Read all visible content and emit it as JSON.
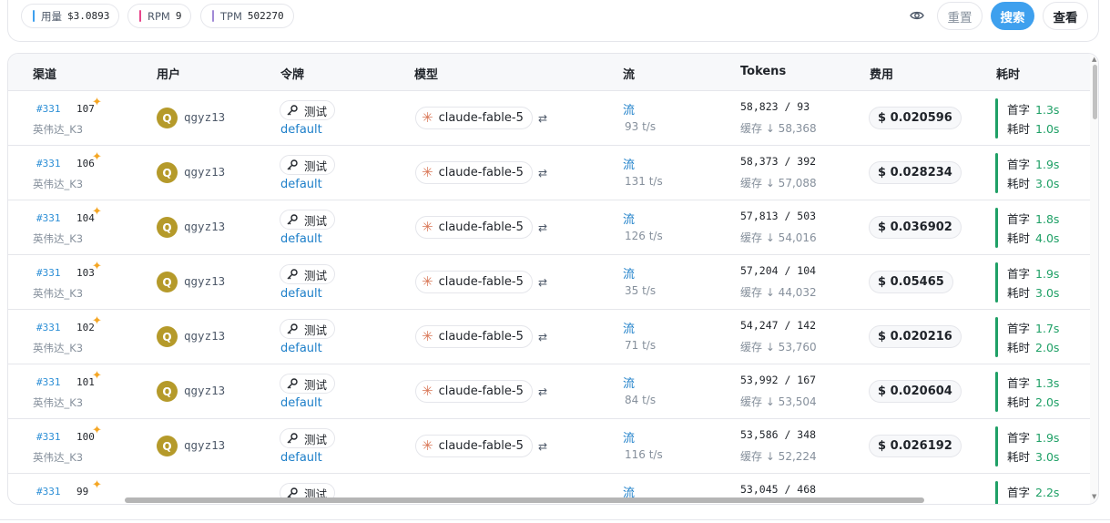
{
  "stats": {
    "usage": {
      "label": "用量",
      "value": "$3.0893",
      "color": "#3ea0ee"
    },
    "rpm": {
      "label": "RPM",
      "value": "9",
      "color": "#e8458b"
    },
    "tpm": {
      "label": "TPM",
      "value": "502270",
      "color": "#a18ad6"
    }
  },
  "actions": {
    "reset": "重置",
    "search": "搜索",
    "view": "查看"
  },
  "columns": {
    "channel": "渠道",
    "user": "用户",
    "token": "令牌",
    "model": "模型",
    "stream": "流",
    "tokens": "Tokens",
    "cost": "费用",
    "duration": "耗时"
  },
  "rows": [
    {
      "channel_id": "#331",
      "num": "107",
      "channel_name": "英伟达_K3",
      "avatar": "Q",
      "user": "qgyz13",
      "token": "测试",
      "group": "default",
      "model": "claude-fable-5",
      "stream": "流",
      "speed": "93 t/s",
      "tokens": "58,823 / 93",
      "cache": "缓存 ↓ 58,368",
      "cost": "$ 0.020596",
      "first_label": "首字",
      "first": "1.3s",
      "total_label": "耗时",
      "total": "1.0s"
    },
    {
      "channel_id": "#331",
      "num": "106",
      "channel_name": "英伟达_K3",
      "avatar": "Q",
      "user": "qgyz13",
      "token": "测试",
      "group": "default",
      "model": "claude-fable-5",
      "stream": "流",
      "speed": "131 t/s",
      "tokens": "58,373 / 392",
      "cache": "缓存 ↓ 57,088",
      "cost": "$ 0.028234",
      "first_label": "首字",
      "first": "1.9s",
      "total_label": "耗时",
      "total": "3.0s"
    },
    {
      "channel_id": "#331",
      "num": "104",
      "channel_name": "英伟达_K3",
      "avatar": "Q",
      "user": "qgyz13",
      "token": "测试",
      "group": "default",
      "model": "claude-fable-5",
      "stream": "流",
      "speed": "126 t/s",
      "tokens": "57,813 / 503",
      "cache": "缓存 ↓ 54,016",
      "cost": "$ 0.036902",
      "first_label": "首字",
      "first": "1.8s",
      "total_label": "耗时",
      "total": "4.0s"
    },
    {
      "channel_id": "#331",
      "num": "103",
      "channel_name": "英伟达_K3",
      "avatar": "Q",
      "user": "qgyz13",
      "token": "测试",
      "group": "default",
      "model": "claude-fable-5",
      "stream": "流",
      "speed": "35 t/s",
      "tokens": "57,204 / 104",
      "cache": "缓存 ↓ 44,032",
      "cost": "$ 0.05465",
      "first_label": "首字",
      "first": "1.9s",
      "total_label": "耗时",
      "total": "3.0s"
    },
    {
      "channel_id": "#331",
      "num": "102",
      "channel_name": "英伟达_K3",
      "avatar": "Q",
      "user": "qgyz13",
      "token": "测试",
      "group": "default",
      "model": "claude-fable-5",
      "stream": "流",
      "speed": "71 t/s",
      "tokens": "54,247 / 142",
      "cache": "缓存 ↓ 53,760",
      "cost": "$ 0.020216",
      "first_label": "首字",
      "first": "1.7s",
      "total_label": "耗时",
      "total": "2.0s"
    },
    {
      "channel_id": "#331",
      "num": "101",
      "channel_name": "英伟达_K3",
      "avatar": "Q",
      "user": "qgyz13",
      "token": "测试",
      "group": "default",
      "model": "claude-fable-5",
      "stream": "流",
      "speed": "84 t/s",
      "tokens": "53,992 / 167",
      "cache": "缓存 ↓ 53,504",
      "cost": "$ 0.020604",
      "first_label": "首字",
      "first": "1.3s",
      "total_label": "耗时",
      "total": "2.0s"
    },
    {
      "channel_id": "#331",
      "num": "100",
      "channel_name": "英伟达_K3",
      "avatar": "Q",
      "user": "qgyz13",
      "token": "测试",
      "group": "default",
      "model": "claude-fable-5",
      "stream": "流",
      "speed": "116 t/s",
      "tokens": "53,586 / 348",
      "cache": "缓存 ↓ 52,224",
      "cost": "$ 0.026192",
      "first_label": "首字",
      "first": "1.9s",
      "total_label": "耗时",
      "total": "3.0s"
    },
    {
      "channel_id": "#331",
      "num": "99",
      "channel_name": "",
      "avatar": "",
      "user": "",
      "token": "测试",
      "group": "",
      "model": "",
      "stream": "流",
      "speed": "",
      "tokens": "53,045 / 468",
      "cache": "",
      "cost": "",
      "first_label": "首字",
      "first": "2.2s",
      "total_label": "",
      "total": ""
    }
  ]
}
